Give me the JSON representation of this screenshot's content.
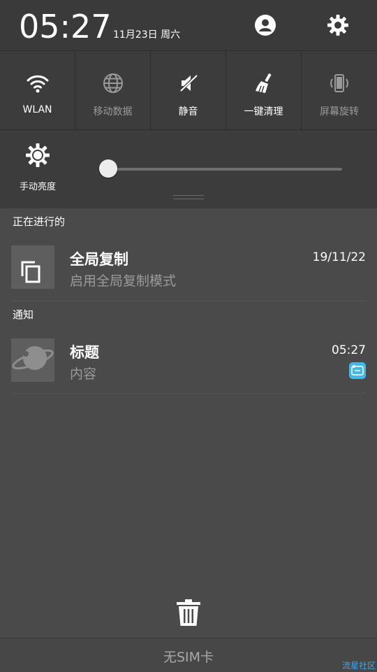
{
  "status_header": {
    "time": "05:27",
    "date": "11月23日 周六",
    "profile_icon": "user-account-icon",
    "settings_icon": "gear-icon"
  },
  "quick_settings": {
    "tiles": [
      {
        "label": "WLAN",
        "icon": "wifi-icon",
        "active": true
      },
      {
        "label": "移动数据",
        "icon": "globe-icon",
        "active": false
      },
      {
        "label": "静音",
        "icon": "speaker-muted-icon",
        "active": true
      },
      {
        "label": "一键清理",
        "icon": "broom-icon",
        "active": true
      },
      {
        "label": "屏幕旋转",
        "icon": "phone-rotate-icon",
        "active": false
      }
    ]
  },
  "brightness": {
    "label": "手动亮度",
    "icon": "brightness-icon",
    "level": 0.0
  },
  "ongoing": {
    "section_title": "正在进行的",
    "item": {
      "title": "全局复制",
      "text": "启用全局复制模式",
      "time": "19/11/22",
      "icon": "copy-icon"
    }
  },
  "notifications": {
    "section_title": "通知",
    "item": {
      "title": "标题",
      "text": "内容",
      "time": "05:27",
      "icon": "planet-icon",
      "small_icon": "app-badge-icon"
    }
  },
  "clear_all_icon": "trash-icon",
  "footer": {
    "carrier_text": "无SIM卡"
  },
  "watermark": "流星社区",
  "colors": {
    "background": "#4a4a4a",
    "panel": "#3c3c3c",
    "text_primary": "#ffffff",
    "text_secondary": "#9a9a9a",
    "accent_badge": "#45b6e6"
  }
}
